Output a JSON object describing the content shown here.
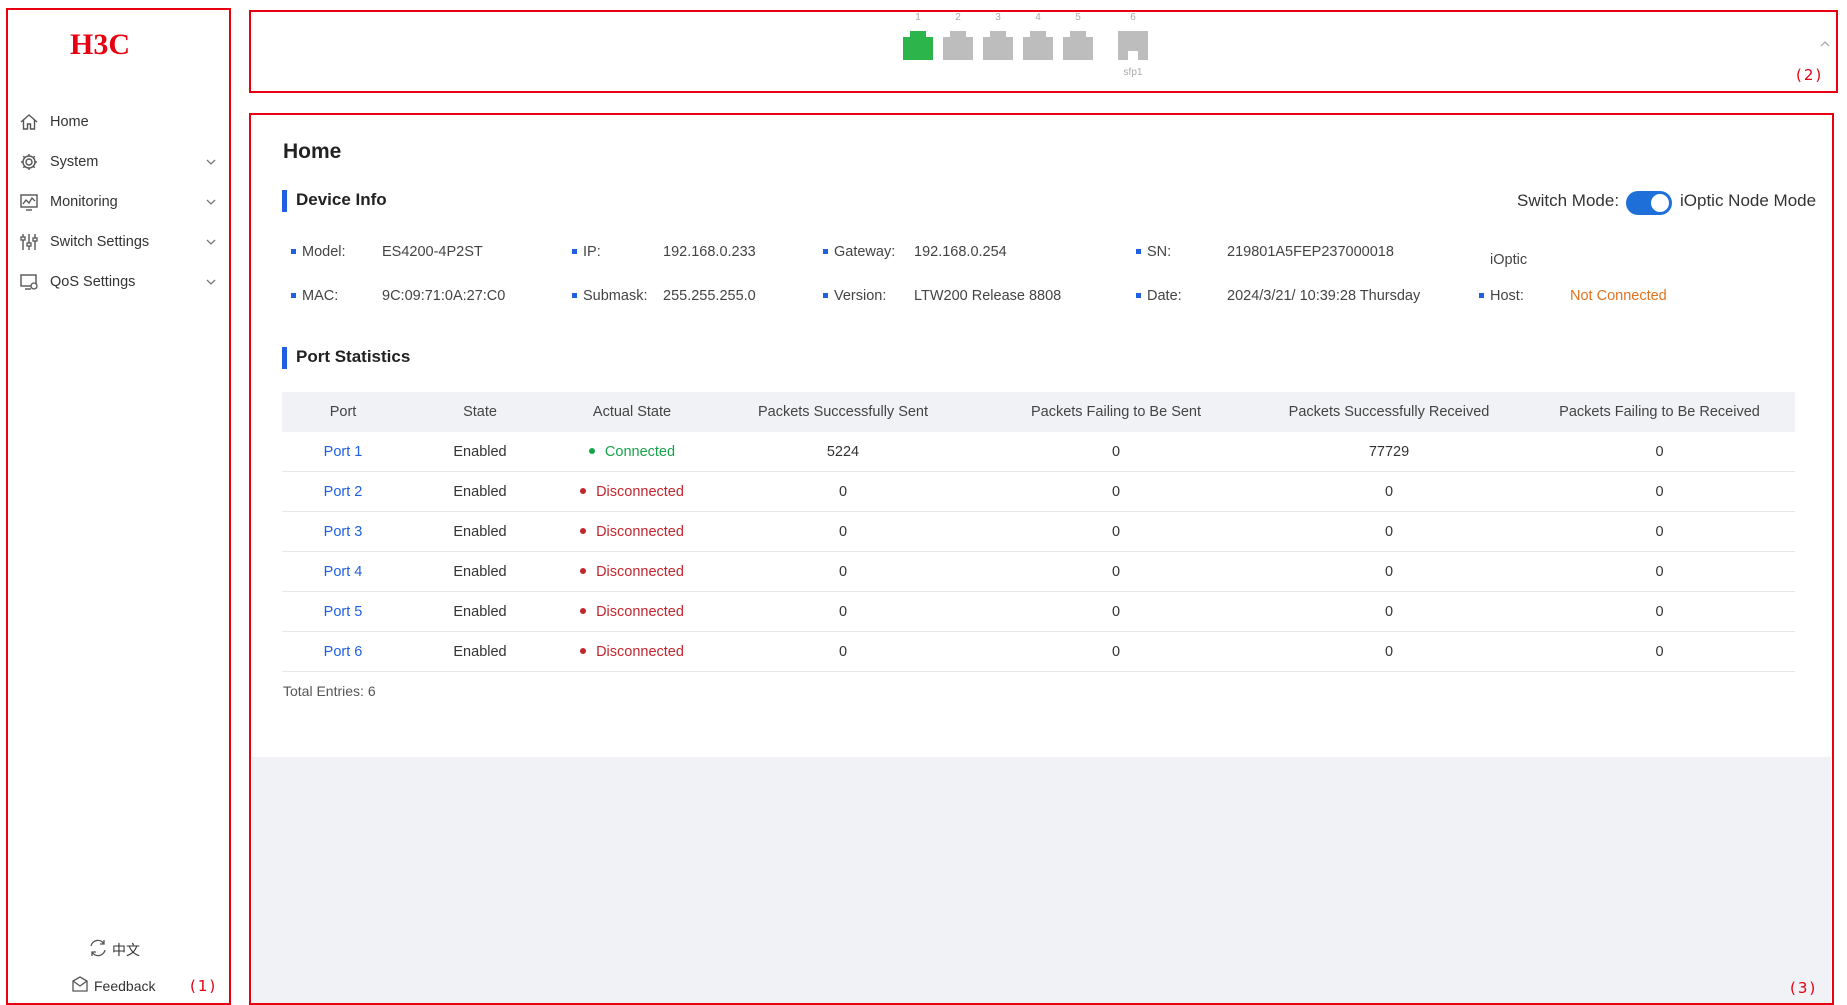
{
  "brand": {
    "logo_text": "H3C"
  },
  "sidebar": {
    "items": [
      {
        "label": "Home",
        "icon": "home-icon",
        "expandable": false
      },
      {
        "label": "System",
        "icon": "gear-icon",
        "expandable": true
      },
      {
        "label": "Monitoring",
        "icon": "monitor-chart-icon",
        "expandable": true
      },
      {
        "label": "Switch Settings",
        "icon": "sliders-icon",
        "expandable": true
      },
      {
        "label": "QoS Settings",
        "icon": "qos-monitor-icon",
        "expandable": true
      }
    ],
    "language_label": "中文",
    "feedback_label": "Feedback"
  },
  "callouts": {
    "sidebar": "(1)",
    "topbar": "(2)",
    "content": "(3)"
  },
  "topbar": {
    "ports": [
      {
        "number": "1",
        "status": "up"
      },
      {
        "number": "2",
        "status": "down"
      },
      {
        "number": "3",
        "status": "down"
      },
      {
        "number": "4",
        "status": "down"
      },
      {
        "number": "5",
        "status": "down"
      },
      {
        "number": "6",
        "status": "down",
        "sub_label": "sfp1"
      }
    ],
    "colors": {
      "up": "#2bb54a",
      "down": "#bdbdbd"
    }
  },
  "main": {
    "page_title": "Home",
    "device_info": {
      "title": "Device Info",
      "switch_mode_label": "Switch Mode:",
      "mode_value": "iOptic Node Mode",
      "switch_on": true,
      "fields": {
        "model_label": "Model:",
        "model": "ES4200-4P2ST",
        "ip_label": "IP:",
        "ip": "192.168.0.233",
        "gateway_label": "Gateway:",
        "gateway": "192.168.0.254",
        "sn_label": "SN:",
        "sn": "219801A5FEP237000018",
        "ioptic_label": "iOptic",
        "mac_label": "MAC:",
        "mac": "9C:09:71:0A:27:C0",
        "submask_label": "Submask:",
        "submask": "255.255.255.0",
        "version_label": "Version:",
        "version": "LTW200 Release 8808",
        "date_label": "Date:",
        "date": "2024/3/21/ 10:39:28 Thursday",
        "host_label": "Host:",
        "host": "Not Connected"
      }
    },
    "port_statistics": {
      "title": "Port Statistics",
      "columns": [
        "Port",
        "State",
        "Actual State",
        "Packets Successfully Sent",
        "Packets Failing to Be Sent",
        "Packets Successfully Received",
        "Packets Failing to Be Received"
      ],
      "rows": [
        {
          "port": "Port 1",
          "state": "Enabled",
          "actual": "Connected",
          "sent": "5224",
          "fail_sent": "0",
          "received": "77729",
          "fail_received": "0"
        },
        {
          "port": "Port 2",
          "state": "Enabled",
          "actual": "Disconnected",
          "sent": "0",
          "fail_sent": "0",
          "received": "0",
          "fail_received": "0"
        },
        {
          "port": "Port 3",
          "state": "Enabled",
          "actual": "Disconnected",
          "sent": "0",
          "fail_sent": "0",
          "received": "0",
          "fail_received": "0"
        },
        {
          "port": "Port 4",
          "state": "Enabled",
          "actual": "Disconnected",
          "sent": "0",
          "fail_sent": "0",
          "received": "0",
          "fail_received": "0"
        },
        {
          "port": "Port 5",
          "state": "Enabled",
          "actual": "Disconnected",
          "sent": "0",
          "fail_sent": "0",
          "received": "0",
          "fail_received": "0"
        },
        {
          "port": "Port 6",
          "state": "Enabled",
          "actual": "Disconnected",
          "sent": "0",
          "fail_sent": "0",
          "received": "0",
          "fail_received": "0"
        }
      ],
      "total_label": "Total Entries: 6"
    }
  }
}
